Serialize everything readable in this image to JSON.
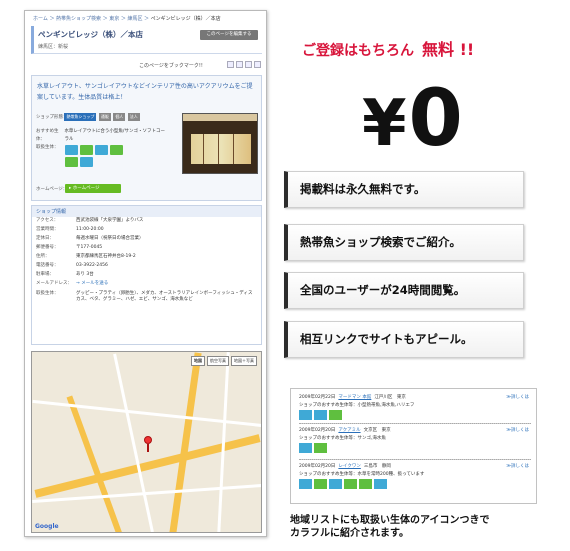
{
  "screenshot": {
    "breadcrumb": [
      "ホーム",
      "熱帯魚ショップ検索",
      "東京",
      "練馬区",
      "ペンギンビレッジ（株）／本店"
    ],
    "shop_name": "ペンギンビレッジ（株）／本店",
    "area": "練馬区：新桜",
    "edit_button": "このページを編集する",
    "bookmark_text": "このページをブックマーク!!",
    "catch_copy": "水草レイアウト、サンゴレイアウトなどインテリア性の高いアクアリウムをご提案しています。生体品質は格上！",
    "features": [
      {
        "label": "ショップ形態：",
        "tags": [
          "熱帯魚ショップ",
          "通販",
          "個人",
          "法人"
        ]
      },
      {
        "label": "おすすめ生体：",
        "value": "水草レイアウトに合う小型魚/サンゴ・ソフトコーラル"
      },
      {
        "label": "取扱生体：",
        "value": ""
      },
      {
        "label": "ホームページ：",
        "value": "ホームページ"
      }
    ],
    "fish_icon_colors": [
      "#3fa9d6",
      "#5fbf3f",
      "#3fa9d6",
      "#5fbf3f",
      "#5fbf3f",
      "#3fa9d6"
    ],
    "info_head": "ショップ情報",
    "info": [
      {
        "label": "アクセス：",
        "value": "西武池袋線「大泉学園」よりバス"
      },
      {
        "label": "営業時間：",
        "value": "11:00-20:00"
      },
      {
        "label": "定休日：",
        "value": "毎週水曜日（祝祭日の場合営業）"
      },
      {
        "label": "郵便番号：",
        "value": "〒177-0045"
      },
      {
        "label": "住所：",
        "value": "東京都練馬区石神井台8-19-2"
      },
      {
        "label": "電話番号：",
        "value": "03-3922-2456"
      },
      {
        "label": "駐車場：",
        "value": "あり 3台"
      },
      {
        "label": "メールアドレス：",
        "value": "→ メールを送る"
      },
      {
        "label": "取扱生体：",
        "value": "グッピー・プラティ（卵胎生）、メダカ、オーストラリアレインボーフィッシュ・ディスカス、ベタ、グラミー、ハゼ、エビ、サンゴ、海水魚など"
      }
    ],
    "map_tabs": [
      "地図",
      "航空写真",
      "地図＋写真"
    ],
    "map_logo": "Google"
  },
  "promo": {
    "headline": "ご登録はもちろん",
    "headline_bold": "無料 !!",
    "price": "0",
    "price_symbol": "¥",
    "points": [
      "掲載料は永久無料です。",
      "熱帯魚ショップ検索でご紹介。",
      "全国のユーザーが24時間閲覧。",
      "相互リンクでサイトもアピール。"
    ],
    "list": [
      {
        "date": "2009年02月22日",
        "name": "マードマン 本館",
        "area": "江戸川区　東京",
        "desc": "ショップのおすすめ生体等：小型熱帯魚,海水魚,ハリエフ",
        "more": "≫詳しくは"
      },
      {
        "date": "2009年02月20日",
        "name": "アクアミル",
        "area": "文京区　東京",
        "desc": "ショップのおすすめ生体等：サンゴ,海水魚",
        "more": "≫詳しくは"
      },
      {
        "date": "2009年02月20日",
        "name": "レイクワン",
        "area": "三島市　静岡",
        "desc": "ショップのおすすめ生体等：水草を常時200種、扱っています",
        "more": "≫詳しくは"
      }
    ],
    "caption_line1": "地域リストにも取扱い生体のアイコンつきで",
    "caption_line2": "カラフルに紹介されます。"
  }
}
